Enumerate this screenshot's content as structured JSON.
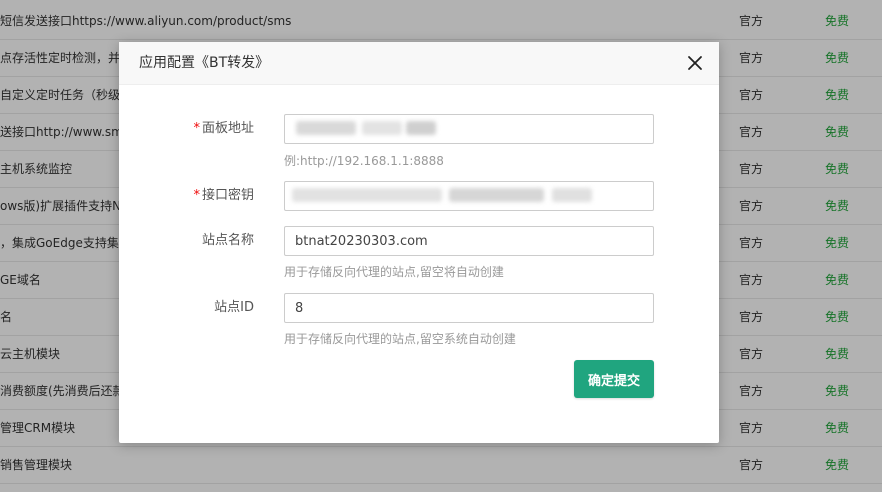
{
  "background_rows": [
    {
      "name": "短信发送接口https://www.aliyun.com/product/sms",
      "source": "官方",
      "price": "免费"
    },
    {
      "name": "点存活性定时检测，并",
      "source": "官方",
      "price": "免费"
    },
    {
      "name": "自定义定时任务（秒级）",
      "source": "官方",
      "price": "免费"
    },
    {
      "name": "送接口http://www.sm",
      "source": "官方",
      "price": "免费"
    },
    {
      "name": "主机系统监控",
      "source": "官方",
      "price": "免费"
    },
    {
      "name": "ows版)扩展插件支持N",
      "source": "官方",
      "price": "免费"
    },
    {
      "name": "，集成GoEdge支持集",
      "source": "官方",
      "price": "免费"
    },
    {
      "name": "GE域名",
      "source": "官方",
      "price": "免费"
    },
    {
      "name": "名",
      "source": "官方",
      "price": "免费"
    },
    {
      "name": "云主机模块",
      "source": "官方",
      "price": "免费"
    },
    {
      "name": "消费额度(先消费后还款",
      "source": "官方",
      "price": "免费"
    },
    {
      "name": "管理CRM模块",
      "source": "官方",
      "price": "免费"
    },
    {
      "name": "销售管理模块",
      "source": "官方",
      "price": "免费"
    }
  ],
  "modal": {
    "title": "应用配置《BT转发》",
    "close_icon": "close-icon",
    "fields": {
      "panel_address": {
        "required_mark": "*",
        "label": "面板地址",
        "value": "",
        "help": "例:http://192.168.1.1:8888"
      },
      "api_key": {
        "required_mark": "*",
        "label": "接口密钥",
        "value": ""
      },
      "site_name": {
        "label": "站点名称",
        "value": "btnat20230303.com",
        "help": "用于存储反向代理的站点,留空将自动创建"
      },
      "site_id": {
        "label": "站点ID",
        "value": "8",
        "help": "用于存储反向代理的站点,留空系统自动创建"
      }
    },
    "submit_label": "确定提交"
  }
}
